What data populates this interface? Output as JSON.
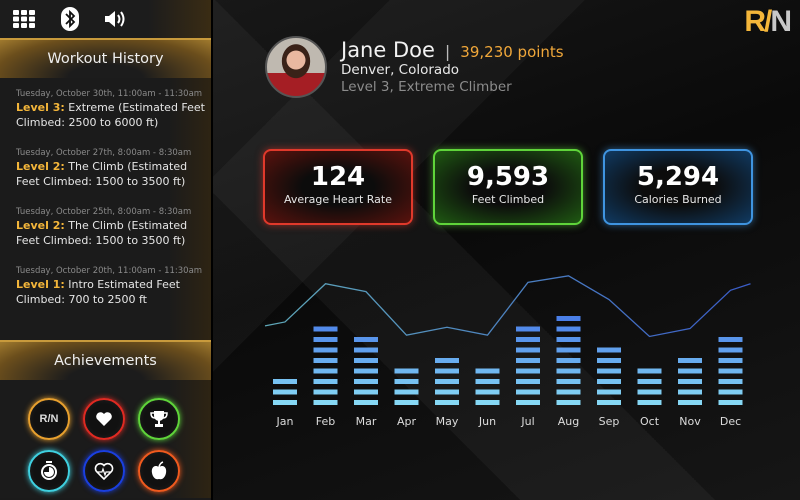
{
  "topbar": {
    "icons": [
      {
        "name": "apps-grid-icon",
        "glyph": "grid"
      },
      {
        "name": "bluetooth-icon",
        "glyph": "bluetooth"
      },
      {
        "name": "volume-icon",
        "glyph": "speaker"
      }
    ]
  },
  "logo": {
    "left": "R/",
    "right": "N",
    "left_color": "#f4b63a",
    "right_color": "#c8c8c8"
  },
  "workout_history": {
    "title": "Workout History",
    "items": [
      {
        "date": "Tuesday, October 30th, 11:00am - 11:30am",
        "level": "Level 3:",
        "text": " Extreme (Estimated Feet Climbed: 2500 to 6000 ft)"
      },
      {
        "date": "Tuesday, October 27th, 8:00am - 8:30am",
        "level": "Level 2:",
        "text": " The Climb (Estimated Feet Climbed: 1500 to 3500 ft)"
      },
      {
        "date": "Tuesday, October 25th, 8:00am - 8:30am",
        "level": "Level 2:",
        "text": " The Climb (Estimated Feet Climbed: 1500 to 3500 ft)"
      },
      {
        "date": "Tuesday, October 20th, 11:00am - 11:30am",
        "level": "Level 1:",
        "text": " Intro Estimated Feet Climbed: 700 to 2500 ft"
      }
    ]
  },
  "achievements": {
    "title": "Achievements",
    "badges": [
      {
        "name": "ryan-logo-badge",
        "glyph": "R/N",
        "color": "#e8a02e"
      },
      {
        "name": "heart-badge",
        "glyph": "♥",
        "color": "#e02a22"
      },
      {
        "name": "trophy-badge",
        "glyph": "🏆",
        "color": "#5fd43a"
      },
      {
        "name": "stopwatch-badge",
        "glyph": "⏱",
        "color": "#3fd0e0"
      },
      {
        "name": "heartbeat-badge",
        "glyph": "♡",
        "color": "#1a3fe0"
      },
      {
        "name": "apple-badge",
        "glyph": "●",
        "color": "#f05a1e"
      }
    ]
  },
  "profile": {
    "name": "Jane Doe",
    "separator": "|",
    "points": "39,230 points",
    "location": "Denver, Colorado",
    "level": "Level 3, Extreme Climber"
  },
  "stats": {
    "heart_rate": {
      "value": "124",
      "label": "Average Heart Rate",
      "color": "#e0392b"
    },
    "feet": {
      "value": "9,593",
      "label": "Feet Climbed",
      "color": "#5fd43a"
    },
    "calories": {
      "value": "5,294",
      "label": "Calories Burned",
      "color": "#3f94e0"
    }
  },
  "chart_data": {
    "type": "bar",
    "title": "",
    "xlabel": "",
    "ylabel": "",
    "categories": [
      "Jan",
      "Feb",
      "Mar",
      "Apr",
      "May",
      "Jun",
      "Jul",
      "Aug",
      "Sep",
      "Oct",
      "Nov",
      "Dec"
    ],
    "series": [
      {
        "name": "bar-segments",
        "type": "bar",
        "values": [
          3,
          8,
          7,
          4,
          5,
          4,
          8,
          9,
          6,
          4,
          5,
          7
        ]
      },
      {
        "name": "trend-line",
        "type": "line",
        "values": [
          6.3,
          9.2,
          8.6,
          5.3,
          5.9,
          5.3,
          9.3,
          9.8,
          8.0,
          5.2,
          5.8,
          8.7
        ],
        "start": 6.0,
        "end": 9.2
      }
    ],
    "ylim": [
      0,
      11
    ],
    "grid": false,
    "colors": {
      "bar_bottom": "#86d8f5",
      "bar_top": "#4a7fe8",
      "line_start": "#5fa8b8",
      "line_end": "#3a5cc8"
    }
  }
}
